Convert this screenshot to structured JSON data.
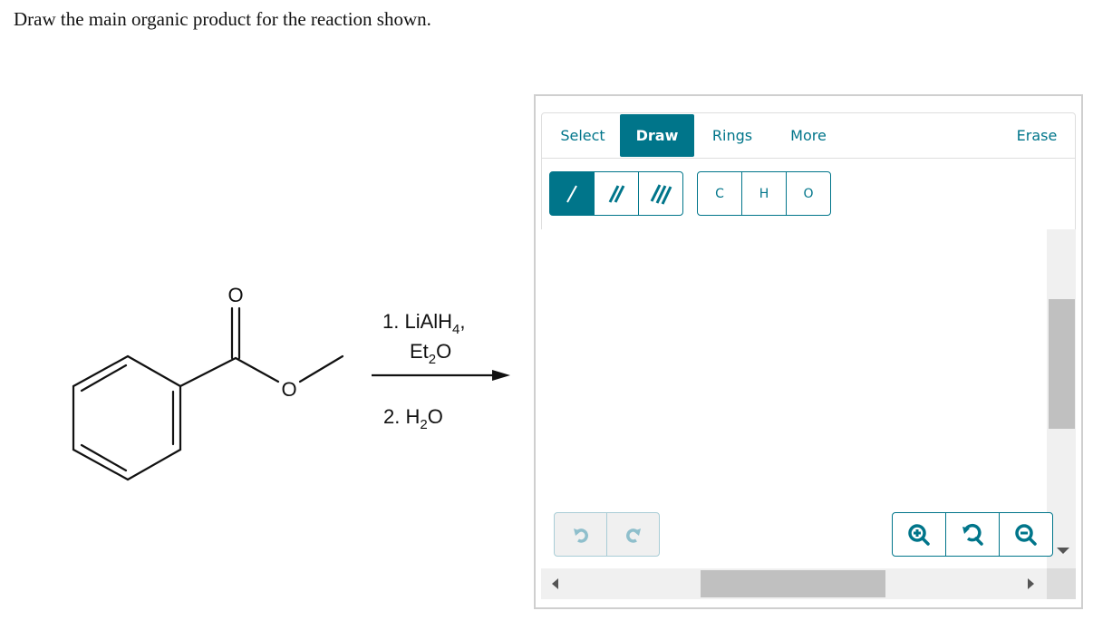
{
  "prompt": "Draw the main organic product for the reaction shown.",
  "reaction": {
    "reactant": "methyl benzoate",
    "atom_labels": {
      "carbonyl_oxygen": "O",
      "ester_oxygen": "O"
    },
    "conditions": {
      "step1_prefix": "1. LiAlH",
      "step1_sub": "4",
      "step1_suffix": ",",
      "step1b_prefix": "Et",
      "step1b_sub": "2",
      "step1b_suffix": "O",
      "step2_prefix": "2. H",
      "step2_sub": "2",
      "step2_suffix": "O"
    }
  },
  "editor": {
    "tabs": [
      {
        "label": "Select",
        "active": false
      },
      {
        "label": "Draw",
        "active": true
      },
      {
        "label": "Rings",
        "active": false
      },
      {
        "label": "More",
        "active": false
      }
    ],
    "erase_label": "Erase",
    "bond_tools": [
      {
        "name": "single-bond",
        "active": true
      },
      {
        "name": "double-bond",
        "active": false
      },
      {
        "name": "triple-bond",
        "active": false
      }
    ],
    "atom_tools": [
      "C",
      "H",
      "O"
    ],
    "undo": {
      "enabled": false
    },
    "redo": {
      "enabled": false
    },
    "zoom_controls": [
      "zoom-in",
      "zoom-reset",
      "zoom-out"
    ],
    "colors": {
      "accent": "#00758a",
      "disabled_icon": "#8fbfcc",
      "scroll_thumb": "#c0c0c0",
      "scroll_track": "#f0f0f0"
    }
  }
}
